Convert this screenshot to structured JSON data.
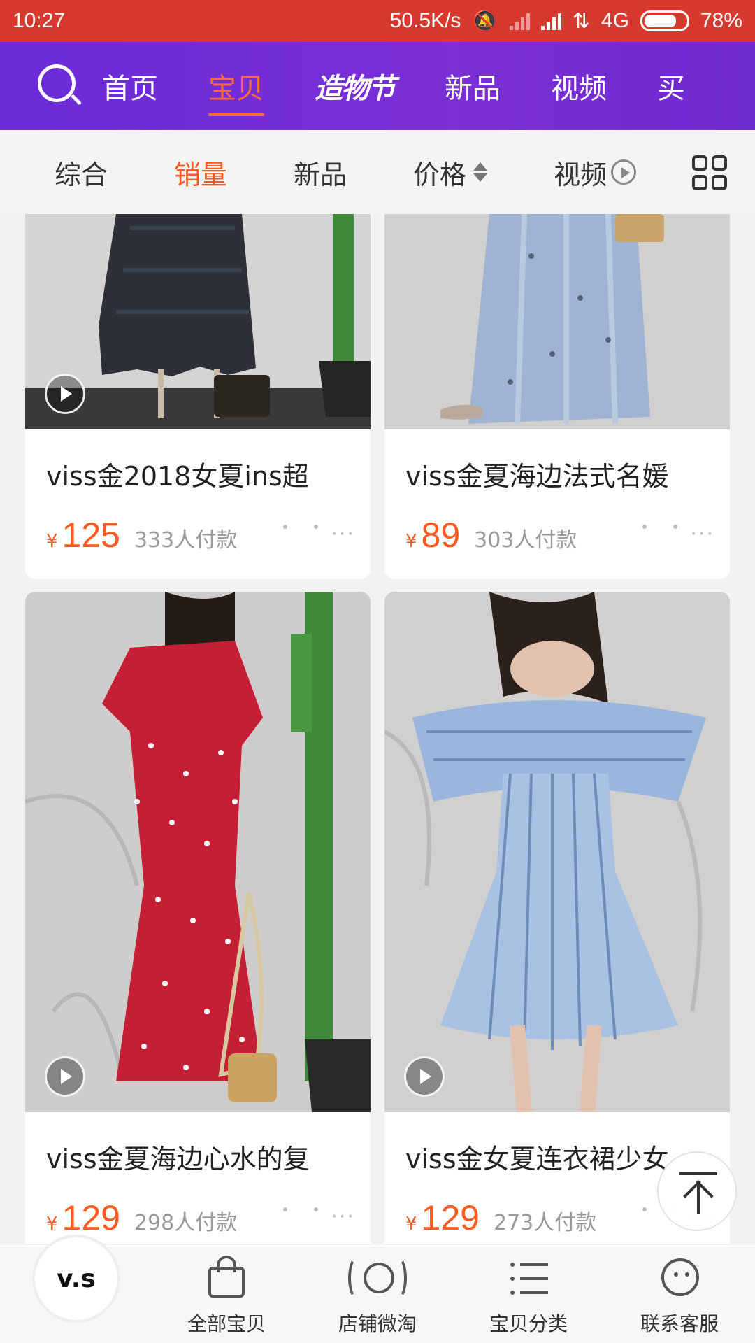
{
  "status": {
    "time": "10:27",
    "speed": "50.5K/s",
    "network": "4G",
    "battery": "78%",
    "battery_level": 0.78
  },
  "topnav": {
    "tabs": [
      "首页",
      "宝贝",
      "造物节",
      "新品",
      "视频",
      "买"
    ],
    "active_index": 1
  },
  "sortbar": {
    "items": [
      "综合",
      "销量",
      "新品",
      "价格",
      "视频"
    ],
    "active_index": 1
  },
  "products": [
    {
      "title": "viss金2018女夏ins超",
      "currency": "¥",
      "price": "125",
      "sales": "333人付款",
      "more": "···"
    },
    {
      "title": "viss金夏海边法式名媛",
      "currency": "¥",
      "price": "89",
      "sales": "303人付款",
      "more": "···"
    },
    {
      "title": "viss金夏海边心水的复",
      "currency": "¥",
      "price": "129",
      "sales": "298人付款",
      "more": "···"
    },
    {
      "title": "viss金女夏连衣裙少女",
      "currency": "¥",
      "price": "129",
      "sales": "273人付款",
      "more": "···"
    }
  ],
  "bottomnav": {
    "shop_logo": "v.s",
    "items": [
      "全部宝贝",
      "店铺微淘",
      "宝贝分类",
      "联系客服"
    ]
  },
  "colors": {
    "status_bar": "#d63a2e",
    "nav_purple": "#6a2bd8",
    "accent": "#ff5a1f"
  }
}
